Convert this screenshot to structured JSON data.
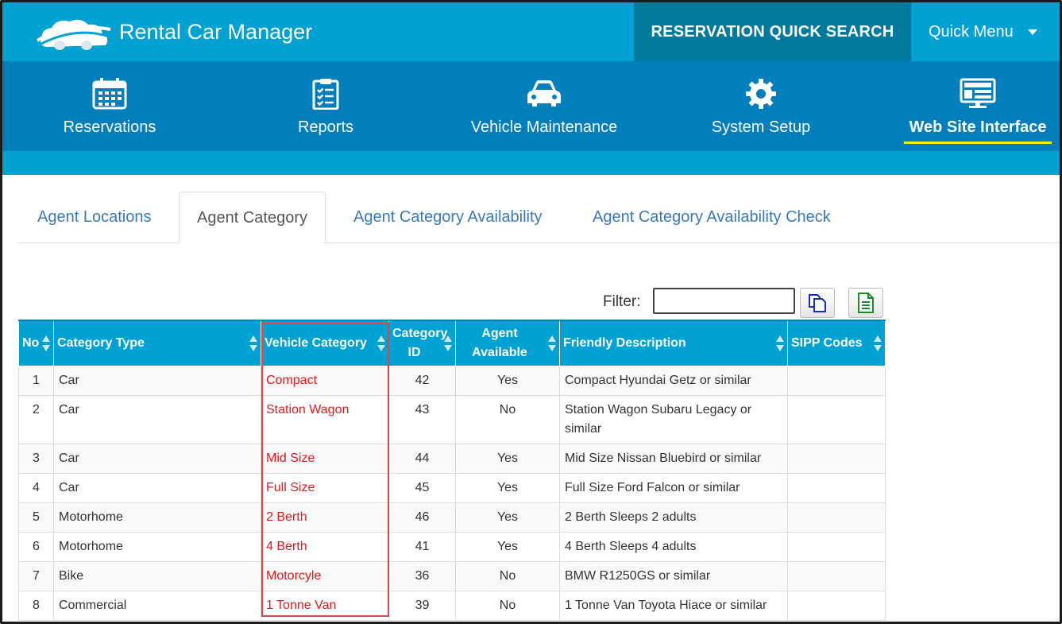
{
  "app": {
    "title": "Rental Car Manager",
    "quick_search": "RESERVATION QUICK SEARCH",
    "quick_menu": "Quick Menu"
  },
  "nav": [
    {
      "label": "Reservations",
      "icon": "calendar-icon"
    },
    {
      "label": "Reports",
      "icon": "checklist-icon"
    },
    {
      "label": "Vehicle Maintenance",
      "icon": "car-icon"
    },
    {
      "label": "System Setup",
      "icon": "gear-icon"
    },
    {
      "label": "Web Site Interface",
      "icon": "monitor-icon",
      "active": true
    }
  ],
  "tabs": [
    {
      "label": "Agent Locations"
    },
    {
      "label": "Agent Category",
      "active": true
    },
    {
      "label": "Agent Category Availability"
    },
    {
      "label": "Agent Category Availability Check"
    }
  ],
  "filter": {
    "label": "Filter:",
    "value": ""
  },
  "table": {
    "headers": [
      "No",
      "Category Type",
      "Vehicle Category",
      "Category ID",
      "Agent Available",
      "Friendly Description",
      "SIPP Codes"
    ],
    "rows": [
      [
        "1",
        "Car",
        "Compact",
        "42",
        "Yes",
        "Compact Hyundai Getz or similar",
        ""
      ],
      [
        "2",
        "Car",
        "Station Wagon",
        "43",
        "No",
        "Station Wagon Subaru Legacy or similar",
        ""
      ],
      [
        "3",
        "Car",
        "Mid Size",
        "44",
        "Yes",
        "Mid Size Nissan Bluebird or similar",
        ""
      ],
      [
        "4",
        "Car",
        "Full Size",
        "45",
        "Yes",
        "Full Size Ford Falcon or similar",
        ""
      ],
      [
        "5",
        "Motorhome",
        "2 Berth",
        "46",
        "Yes",
        "2 Berth Sleeps 2 adults",
        ""
      ],
      [
        "6",
        "Motorhome",
        "4 Berth",
        "41",
        "Yes",
        "4 Berth Sleeps 4 adults",
        ""
      ],
      [
        "7",
        "Bike",
        "Motorcyle",
        "36",
        "No",
        "BMW R1250GS or similar",
        ""
      ],
      [
        "8",
        "Commercial",
        "1 Tonne Van",
        "39",
        "No",
        "1 Tonne Van Toyota Hiace or similar",
        ""
      ]
    ]
  },
  "colors": {
    "top_bar": "#00a2d3",
    "nav_bar": "#017fbd",
    "quick_search_bg": "#00799f",
    "active_underline": "#f5f200",
    "vehicle_category_text": "#e0191c",
    "highlight_border": "#e34444"
  }
}
